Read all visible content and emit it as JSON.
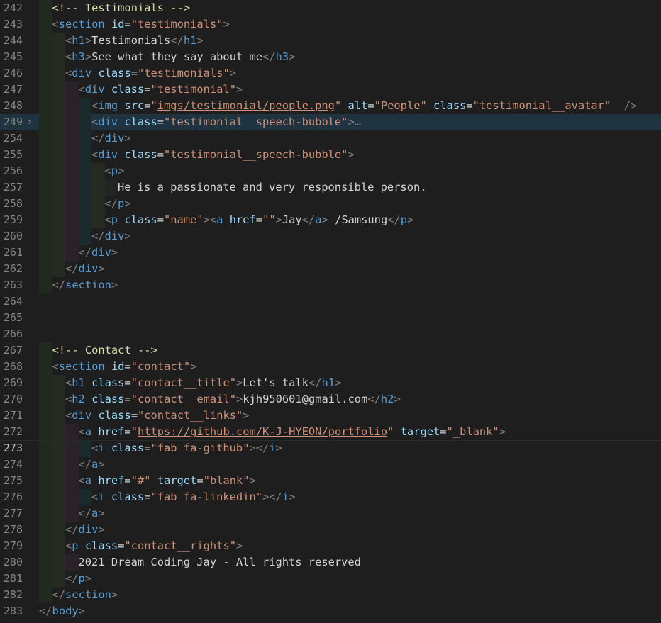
{
  "editor": {
    "language": "html",
    "current_line": 273,
    "highlighted_line": 249,
    "lines": [
      {
        "n": "242",
        "text": "<!-- Testimonials -->"
      },
      {
        "n": "243",
        "text": "<section id=\"testimonials\">"
      },
      {
        "n": "244",
        "text": "<h1>Testimonials</h1>"
      },
      {
        "n": "245",
        "text": "<h3>See what they say about me</h3>"
      },
      {
        "n": "246",
        "text": "<div class=\"testimonials\">"
      },
      {
        "n": "247",
        "text": "<div class=\"testimonial\">"
      },
      {
        "n": "248",
        "text": "<img src=\"imgs/testimonial/people.png\" alt=\"People\" class=\"testimonial__avatar\" />"
      },
      {
        "n": "249",
        "text": "<div class=\"testimonial__speech-bubble\">…"
      },
      {
        "n": "254",
        "text": "</div>"
      },
      {
        "n": "255",
        "text": "<div class=\"testimonial__speech-bubble\">"
      },
      {
        "n": "256",
        "text": "<p>"
      },
      {
        "n": "257",
        "text": "He is a passionate and very responsible person."
      },
      {
        "n": "258",
        "text": "</p>"
      },
      {
        "n": "259",
        "text": "<p class=\"name\"><a href=\"\">Jay</a> /Samsung</p>"
      },
      {
        "n": "260",
        "text": "</div>"
      },
      {
        "n": "261",
        "text": "</div>"
      },
      {
        "n": "262",
        "text": "</div>"
      },
      {
        "n": "263",
        "text": "</section>"
      },
      {
        "n": "264",
        "text": ""
      },
      {
        "n": "265",
        "text": ""
      },
      {
        "n": "266",
        "text": ""
      },
      {
        "n": "267",
        "text": "<!-- Contact -->"
      },
      {
        "n": "268",
        "text": "<section id=\"contact\">"
      },
      {
        "n": "269",
        "text": "<h1 class=\"contact__title\">Let's talk</h1>"
      },
      {
        "n": "270",
        "text": "<h2 class=\"contact__email\">kjh950601@gmail.com</h2>"
      },
      {
        "n": "271",
        "text": "<div class=\"contact__links\">"
      },
      {
        "n": "272",
        "text": "<a href=\"https://github.com/K-J-HYEON/portfolio\" target=\"_blank\">"
      },
      {
        "n": "273",
        "text": "<i class=\"fab fa-github\"></i>"
      },
      {
        "n": "274",
        "text": "</a>"
      },
      {
        "n": "275",
        "text": "<a href=\"#\" target=\"blank\">"
      },
      {
        "n": "276",
        "text": "<i class=\"fab fa-linkedin\"></i>"
      },
      {
        "n": "277",
        "text": "</a>"
      },
      {
        "n": "278",
        "text": "</div>"
      },
      {
        "n": "279",
        "text": "<p class=\"contact__rights\">"
      },
      {
        "n": "280",
        "text": "2021 Dream Coding Jay - All rights reserved"
      },
      {
        "n": "281",
        "text": "</p>"
      },
      {
        "n": "282",
        "text": "</section>"
      },
      {
        "n": "283",
        "text": "</body>"
      }
    ],
    "fold_marker_glyph": "›",
    "colors": {
      "background": "#1e1e1e",
      "tag": "#569cd6",
      "attribute": "#9cdcfe",
      "string": "#ce9178",
      "text": "#d4d4d4",
      "bracket": "#808080",
      "line_number": "#858585"
    }
  }
}
